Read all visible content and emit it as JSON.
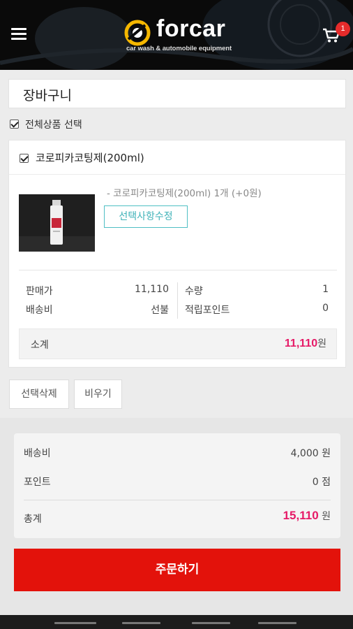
{
  "header": {
    "brand": "forcar",
    "tagline": "car wash & automobile equipment",
    "cart_count": "1"
  },
  "page_title": "장바구니",
  "select_all_label": "전체상품 선택",
  "item": {
    "name": "코로피카코팅제(200ml)",
    "option_text": "- 코로피카코팅제(200ml) 1개 (+0원)",
    "edit_option_label": "선택사항수정",
    "sale_price_label": "판매가",
    "sale_price": "11,110",
    "shipping_label": "배송비",
    "shipping_value": "선불",
    "quantity_label": "수량",
    "quantity": "1",
    "points_label": "적립포인트",
    "points": "0",
    "subtotal_label": "소계",
    "subtotal_value": "11,110",
    "subtotal_unit": "원"
  },
  "actions": {
    "delete_selected": "선택삭제",
    "empty_cart": "비우기"
  },
  "summary": {
    "shipping_label": "배송비",
    "shipping_value": "4,000 원",
    "points_label": "포인트",
    "points_value": "0 점",
    "total_label": "총계",
    "total_value": "15,110",
    "total_unit": "원"
  },
  "order_button": "주문하기",
  "colors": {
    "accent_pink": "#e61a67",
    "order_red": "#e3120b",
    "edit_teal": "#3fb2b8"
  }
}
